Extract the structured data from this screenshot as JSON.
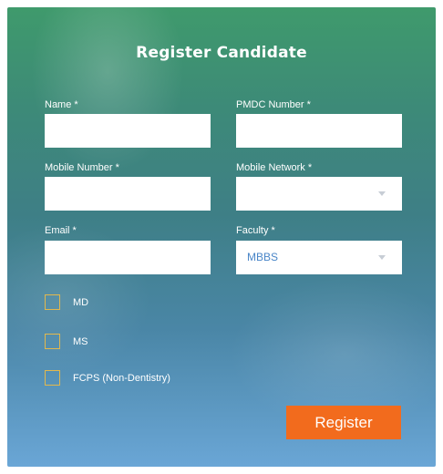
{
  "form": {
    "title": "Register Candidate",
    "fields": {
      "name": {
        "label": "Name *",
        "value": ""
      },
      "pmdc": {
        "label": "PMDC Number *",
        "value": ""
      },
      "mobile_number": {
        "label": "Mobile Number *",
        "value": ""
      },
      "mobile_network": {
        "label": "Mobile Network *",
        "selected": ""
      },
      "email": {
        "label": "Email *",
        "value": ""
      },
      "faculty": {
        "label": "Faculty *",
        "selected": "MBBS"
      }
    },
    "checkboxes": [
      {
        "label": "MD",
        "checked": false
      },
      {
        "label": "MS",
        "checked": false
      },
      {
        "label": "FCPS (Non-Dentistry)",
        "checked": false
      }
    ],
    "register_label": "Register"
  },
  "colors": {
    "accent": "#f26b1d",
    "checkbox_border": "#e2b84d",
    "select_text": "#4a86c8"
  },
  "icons": {
    "dropdown": "chevron-down-icon"
  }
}
